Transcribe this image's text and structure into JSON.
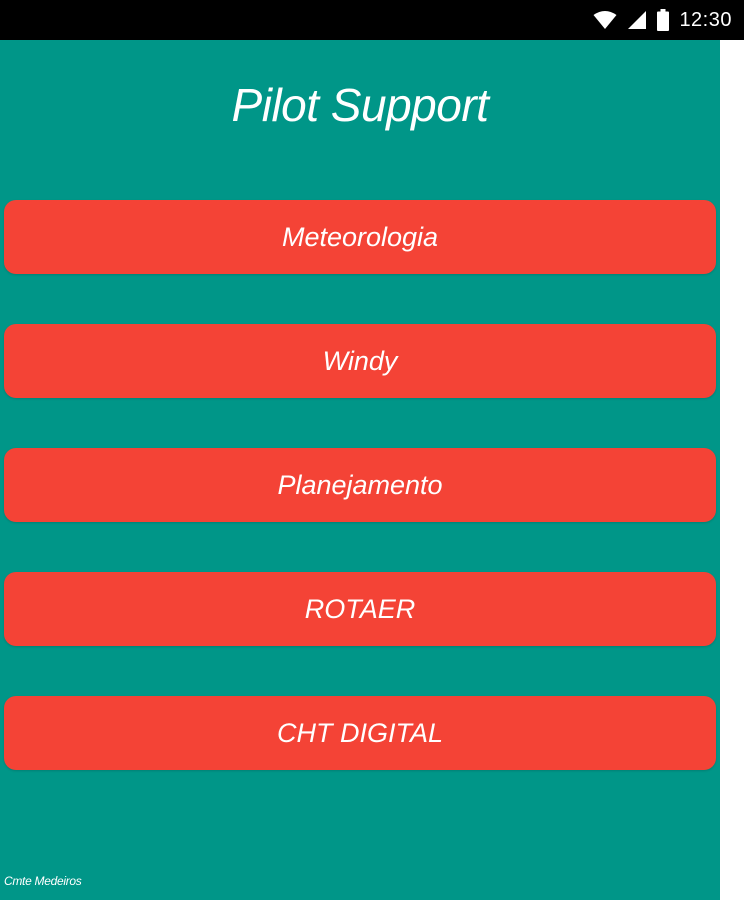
{
  "status_bar": {
    "time": "12:30",
    "icons": [
      "wifi-icon",
      "signal-icon",
      "battery-icon"
    ]
  },
  "app": {
    "title": "Pilot Support",
    "background_color": "#009688",
    "button_color": "#f44336",
    "buttons": [
      {
        "label": "Meteorologia"
      },
      {
        "label": "Windy"
      },
      {
        "label": "Planejamento"
      },
      {
        "label": "ROTAER"
      },
      {
        "label": "CHT DIGITAL"
      }
    ],
    "author": "Cmte Medeiros"
  }
}
